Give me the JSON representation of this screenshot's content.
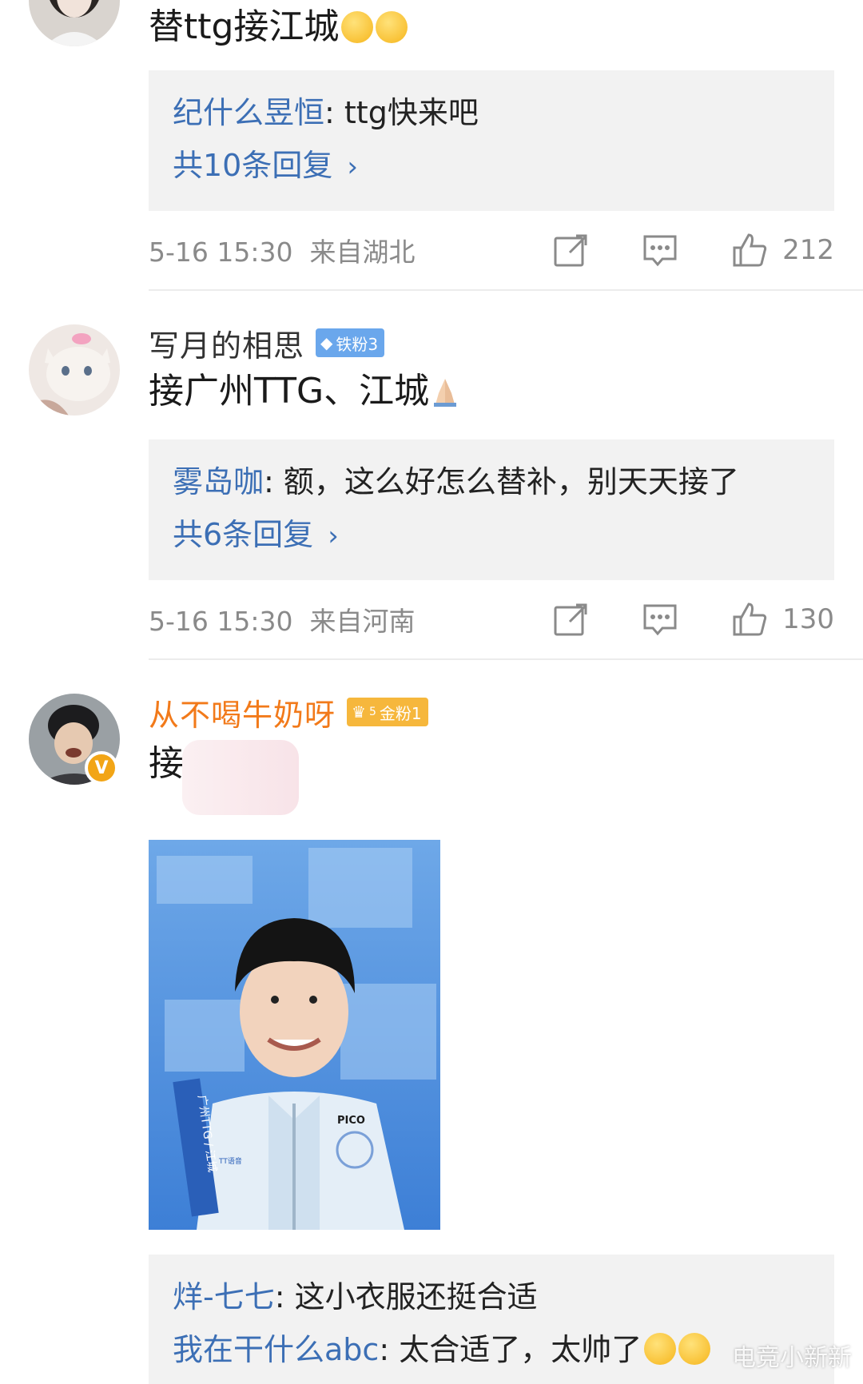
{
  "comment1": {
    "text": "替ttg接江城",
    "reply_user": "纪什么昱恒",
    "reply_text": ": ttg快来吧",
    "reply_more": "共10条回复",
    "time": "5-16 15:30",
    "location": "来自湖北",
    "likes": "212"
  },
  "comment2": {
    "name": "写月的相思",
    "badge": "铁粉3",
    "text": "接广州TTG、江城",
    "reply_user": "雾岛咖",
    "reply_text": ": 额，这么好怎么替补，别天天接了",
    "reply_more": "共6条回复",
    "time": "5-16 15:30",
    "location": "来自河南",
    "likes": "130"
  },
  "comment3": {
    "name": "从不喝牛奶呀",
    "badge": "金粉1",
    "badge_level": "5",
    "verified": "V",
    "text": "接",
    "photo_side_text": "广州TTG / 江城",
    "photo_logo": "PICO",
    "photo_chest_logo": "TT语音",
    "replies": [
      {
        "user": "烊-七七",
        "text": ": 这小衣服还挺合适"
      },
      {
        "user": "我在干什么abc",
        "text": ": 太合适了，太帅了"
      }
    ]
  },
  "watermark": "电竞小新新",
  "colors": {
    "link_blue": "#3c6fb5",
    "gold_name": "#f27a1a",
    "meta_gray": "#8a8a8a",
    "reply_bg": "#f2f2f2"
  },
  "icons": [
    "share-icon",
    "comment-icon",
    "like-icon",
    "chevron-right-icon",
    "verified-icon",
    "diamond-icon",
    "crown-icon"
  ]
}
